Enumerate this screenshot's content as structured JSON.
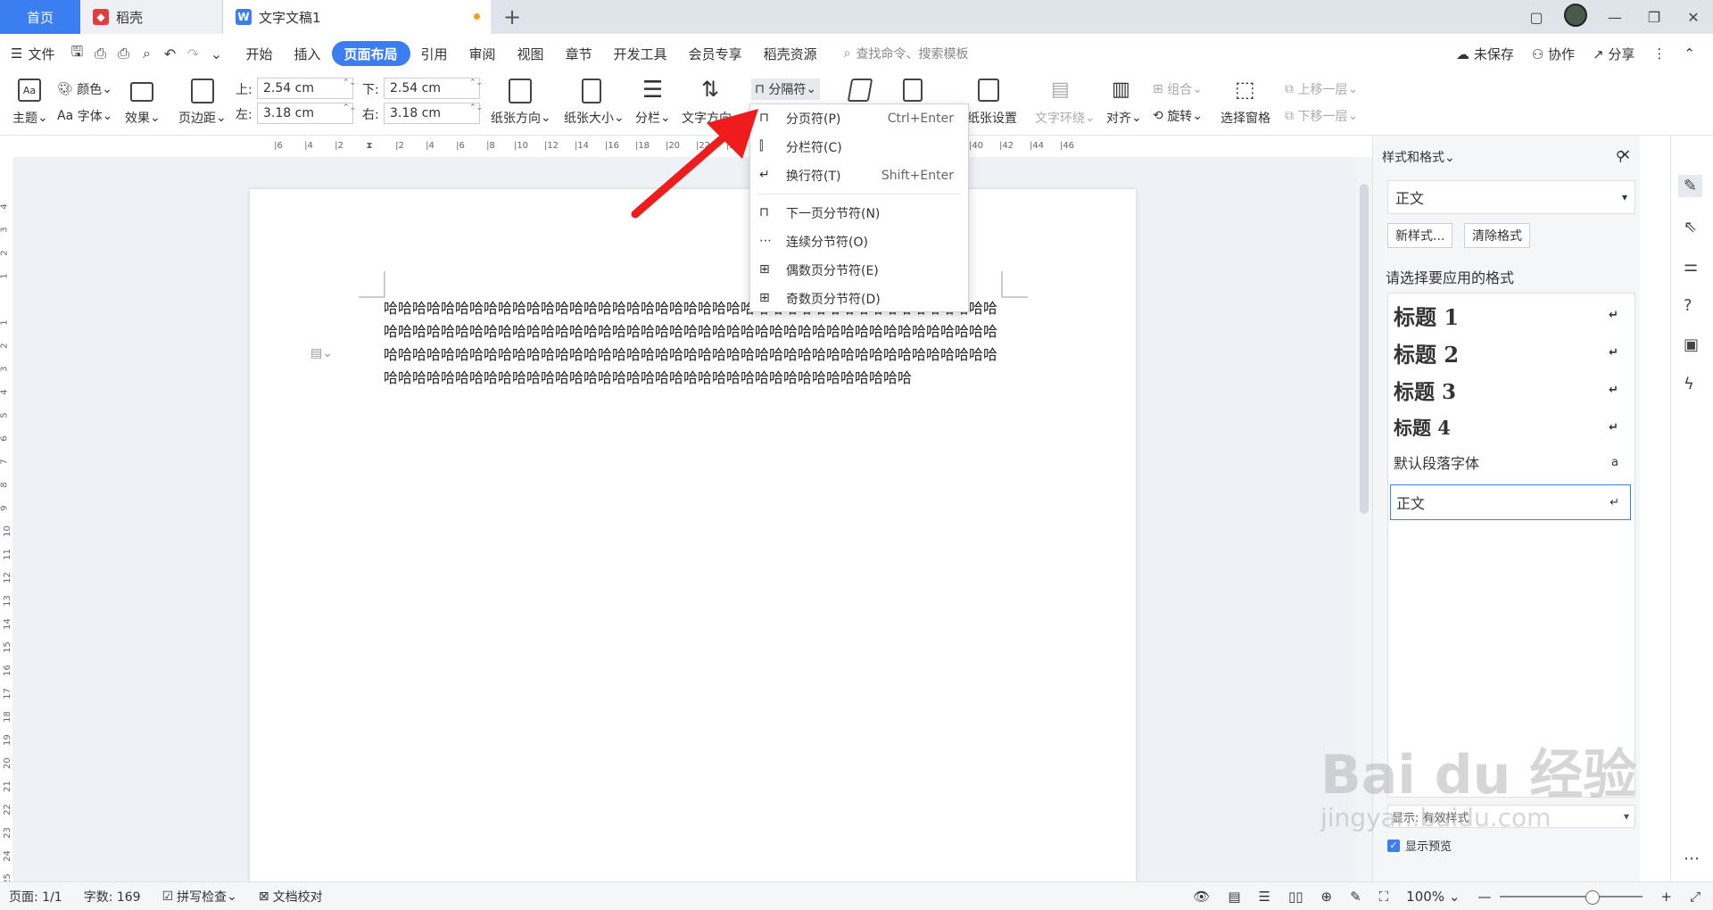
{
  "tabs": {
    "home": "首页",
    "daoke": "稻壳",
    "doc": "文字文稿1"
  },
  "menu": {
    "file": "文件",
    "items": [
      "开始",
      "插入",
      "页面布局",
      "引用",
      "审阅",
      "视图",
      "章节",
      "开发工具",
      "会员专享",
      "稻壳资源"
    ],
    "search": "查找命令、搜索模板",
    "unsaved": "未保存",
    "collab": "协作",
    "share": "分享"
  },
  "ribbon": {
    "theme": "主题",
    "color": "颜色",
    "font": "字体",
    "effect": "效果",
    "margins": "页边距",
    "top_label": "上:",
    "top_val": "2.54 cm",
    "bottom_label": "下:",
    "bottom_val": "2.54 cm",
    "left_label": "左:",
    "left_val": "3.18 cm",
    "right_label": "右:",
    "right_val": "3.18 cm",
    "orientation": "纸张方向",
    "size": "纸张大小",
    "columns": "分栏",
    "textdir": "文字方向",
    "separator": "分隔符",
    "paper_setup": "纸张设置",
    "wrap": "文字环绕",
    "align": "对齐",
    "rotate": "旋转",
    "group": "组合",
    "select_pane": "选择窗格",
    "up_layer": "上移一层",
    "down_layer": "下移一层"
  },
  "dropdown": {
    "items": [
      {
        "label": "分页符(P)",
        "key": "Ctrl+Enter"
      },
      {
        "label": "分栏符(C)",
        "key": ""
      },
      {
        "label": "换行符(T)",
        "key": "Shift+Enter"
      },
      {
        "label": "下一页分节符(N)",
        "key": ""
      },
      {
        "label": "连续分节符(O)",
        "key": ""
      },
      {
        "label": "偶数页分节符(E)",
        "key": ""
      },
      {
        "label": "奇数页分节符(D)",
        "key": ""
      }
    ]
  },
  "document": {
    "text": "哈哈哈哈哈哈哈哈哈哈哈哈哈哈哈哈哈哈哈哈哈哈哈哈哈哈哈哈哈哈哈哈哈哈哈哈哈哈哈哈哈哈哈哈哈哈哈哈哈哈哈哈哈哈哈哈哈哈哈哈哈哈哈哈哈哈哈哈哈哈哈哈哈哈哈哈哈哈哈哈哈哈哈哈哈哈哈哈哈哈哈哈哈哈哈哈哈哈哈哈哈哈哈哈哈哈哈哈哈哈哈哈哈哈哈哈哈哈哈哈哈哈哈哈哈哈哈哈哈哈哈哈哈哈哈哈哈哈哈哈哈哈哈哈哈哈哈哈哈哈哈哈哈哈哈哈哈哈哈哈哈哈哈哈哈哈"
  },
  "ruler": {
    "h": [
      "6",
      "4",
      "2",
      "",
      "2",
      "4",
      "6",
      "8",
      "10",
      "12",
      "14",
      "16",
      "18",
      "20",
      "22",
      "24",
      "26",
      "28",
      "30",
      "32",
      "34",
      "36",
      "38",
      "40",
      "42",
      "44",
      "46"
    ],
    "v": [
      "4",
      "3",
      "2",
      "1",
      "",
      "1",
      "2",
      "3",
      "4",
      "5",
      "6",
      "7",
      "8",
      "9",
      "10",
      "11",
      "12",
      "13",
      "14",
      "15",
      "16",
      "17",
      "18",
      "19",
      "20",
      "21",
      "22",
      "23",
      "24",
      "25"
    ]
  },
  "pane": {
    "title": "样式和格式",
    "current": "正文",
    "new_style": "新样式...",
    "clear": "清除格式",
    "prompt": "请选择要应用的格式",
    "styles": [
      {
        "label": "标题 1"
      },
      {
        "label": "标题 2"
      },
      {
        "label": "标题 3"
      },
      {
        "label": "标题 4"
      },
      {
        "label": "默认段落字体"
      },
      {
        "label": "正文"
      }
    ],
    "show": "显示: 有效样式",
    "preview": "显示预览"
  },
  "status": {
    "page": "页面: 1/1",
    "words": "字数: 169",
    "spell": "拼写检查",
    "proof": "文档校对",
    "zoom": "100%"
  },
  "watermark": {
    "line1": "Bai du 经验",
    "line2": "jingyan.baidu.com"
  }
}
